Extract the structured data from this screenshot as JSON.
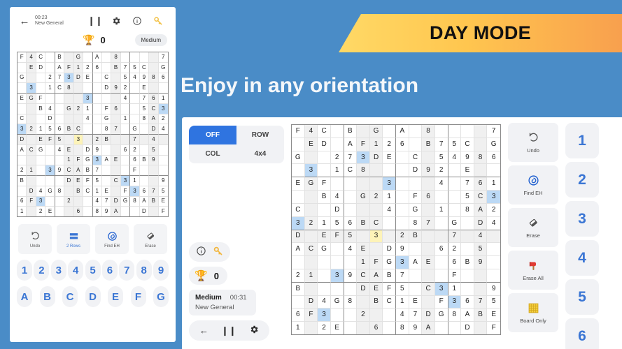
{
  "banner": {
    "text": "DAY MODE"
  },
  "headline": {
    "text": "Enjoy in any orientation"
  },
  "phone": {
    "header": {
      "time": "00:23",
      "name": "New General",
      "back_icon": "back-arrow-icon",
      "pause_icon": "pause-icon",
      "settings_icon": "gear-icon",
      "info_icon": "info-icon",
      "key_icon": "key-icon"
    },
    "score": {
      "value": "0",
      "difficulty": "Medium"
    },
    "tools": [
      {
        "label": "Undo",
        "icon": "undo-icon",
        "active": false
      },
      {
        "label": "2 Rows",
        "icon": "rows-icon",
        "active": true
      },
      {
        "label": "Find EH",
        "icon": "find-icon",
        "active": false
      },
      {
        "label": "Erase",
        "icon": "eraser-icon",
        "active": false
      }
    ],
    "numbers": [
      "1",
      "2",
      "3",
      "4",
      "5",
      "6",
      "7",
      "8",
      "9"
    ],
    "letters": [
      "A",
      "B",
      "C",
      "D",
      "E",
      "F",
      "G"
    ]
  },
  "tablet": {
    "segments": [
      {
        "label": "OFF",
        "selected": true
      },
      {
        "label": "ROW",
        "selected": false
      },
      {
        "label": "COL",
        "selected": false
      },
      {
        "label": "4x4",
        "selected": false
      }
    ],
    "pill_icons": [
      "info-icon",
      "key-icon"
    ],
    "score": {
      "value": "0"
    },
    "info": {
      "difficulty": "Medium",
      "clock": "00:31",
      "name": "New General"
    },
    "nav_icons": [
      "back-arrow-icon",
      "pause-icon",
      "gear-icon"
    ],
    "actions": [
      {
        "label": "Undo",
        "icon": "undo-icon"
      },
      {
        "label": "Find EH",
        "icon": "find-icon"
      },
      {
        "label": "Erase",
        "icon": "eraser-icon"
      },
      {
        "label": "Erase All",
        "icon": "hammer-icon"
      },
      {
        "label": "Board Only",
        "icon": "board-icon"
      }
    ],
    "pads": [
      "1",
      "2",
      "3",
      "4",
      "5",
      "6"
    ]
  },
  "grid": {
    "size": 16,
    "block": 4,
    "cells": [
      [
        "F",
        "4",
        "C",
        "",
        "B",
        "",
        "G",
        "",
        "A",
        "",
        "8",
        "",
        "",
        "",
        "",
        "7"
      ],
      [
        "",
        "E",
        "D",
        "",
        "A",
        "F",
        "1",
        "2",
        "6",
        "",
        "B",
        "7",
        "5",
        "C",
        "",
        "G"
      ],
      [
        "G",
        "",
        "",
        "2",
        "7",
        "3",
        "D",
        "E",
        "",
        "C",
        "",
        "5",
        "4",
        "9",
        "8",
        "6"
      ],
      [
        "",
        "3",
        "",
        "1",
        "C",
        "8",
        "",
        "",
        "",
        "D",
        "9",
        "2",
        "",
        "E",
        "",
        ""
      ],
      [
        "E",
        "G",
        "F",
        "",
        "",
        "",
        "",
        "3",
        "",
        "",
        "",
        "4",
        "",
        "7",
        "6",
        "1"
      ],
      [
        "",
        "",
        "B",
        "4",
        "",
        "G",
        "2",
        "1",
        "",
        "F",
        "6",
        "",
        "",
        "5",
        "C",
        "3"
      ],
      [
        "C",
        "",
        "",
        "D",
        "",
        "",
        "",
        "4",
        "",
        "G",
        "",
        "1",
        "",
        "8",
        "A",
        "2"
      ],
      [
        "3",
        "2",
        "1",
        "5",
        "6",
        "B",
        "C",
        "",
        "",
        "8",
        "7",
        "",
        "G",
        "",
        "D",
        "4"
      ],
      [
        "D",
        "",
        "E",
        "F",
        "5",
        "",
        "3",
        "",
        "2",
        "B",
        "",
        "",
        "7",
        "",
        "4",
        ""
      ],
      [
        "A",
        "C",
        "G",
        "",
        "4",
        "E",
        "",
        "D",
        "9",
        "",
        "",
        "6",
        "2",
        "",
        "5",
        ""
      ],
      [
        "",
        "",
        "",
        "",
        "",
        "1",
        "F",
        "G",
        "3",
        "A",
        "E",
        "",
        "6",
        "B",
        "9",
        ""
      ],
      [
        "2",
        "1",
        "",
        "3",
        "9",
        "C",
        "A",
        "B",
        "7",
        "",
        "",
        "",
        "F",
        "",
        "",
        ""
      ],
      [
        "B",
        "",
        "",
        "",
        "",
        "D",
        "E",
        "F",
        "5",
        "",
        "C",
        "3",
        "1",
        "",
        "",
        "9"
      ],
      [
        "",
        "D",
        "4",
        "G",
        "8",
        "",
        "B",
        "C",
        "1",
        "E",
        "",
        "F",
        "3",
        "6",
        "7",
        "5"
      ],
      [
        "6",
        "F",
        "3",
        "",
        "",
        "2",
        "",
        "",
        "4",
        "7",
        "D",
        "G",
        "8",
        "A",
        "B",
        "E"
      ],
      [
        "1",
        "",
        "2",
        "E",
        "",
        "",
        "6",
        "",
        "8",
        "9",
        "A",
        "",
        "",
        "D",
        "",
        "F"
      ]
    ],
    "highlighted": [
      [
        3,
        1
      ],
      [
        2,
        5
      ],
      [
        4,
        7
      ],
      [
        5,
        15
      ],
      [
        7,
        0
      ],
      [
        11,
        3
      ],
      [
        10,
        8
      ],
      [
        12,
        11
      ],
      [
        13,
        12
      ],
      [
        14,
        2
      ]
    ],
    "selected": [
      [
        8,
        6
      ]
    ],
    "shaded_cols": [
      1,
      5,
      6,
      10,
      14
    ],
    "shaded_rows": [
      8
    ]
  }
}
